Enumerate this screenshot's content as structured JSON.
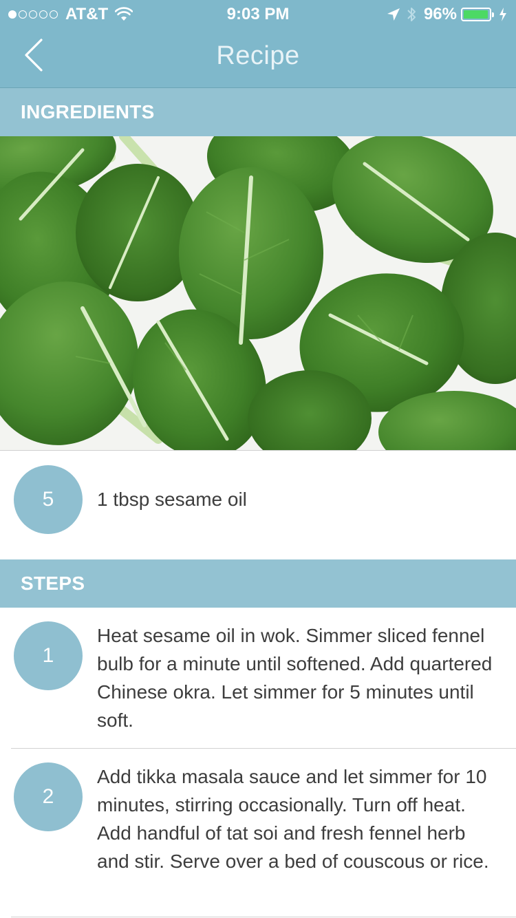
{
  "status_bar": {
    "signal_dots_filled": 1,
    "signal_dots_total": 5,
    "carrier": "AT&T",
    "time": "9:03 PM",
    "battery_percent_text": "96%",
    "battery_level": 0.96,
    "colors": {
      "bar": "#7fb8cb",
      "battery_fill": "#4cd964"
    }
  },
  "nav": {
    "title": "Recipe",
    "back_icon": "chevron-left-icon"
  },
  "ingredients": {
    "header": "INGREDIENTS",
    "items": [
      {
        "badge": "5",
        "text": "1 tbsp sesame oil"
      }
    ]
  },
  "steps": {
    "header": "STEPS",
    "items": [
      {
        "badge": "1",
        "text": "Heat sesame oil in wok. Simmer sliced fennel bulb for a minute until softened. Add quartered Chinese okra. Let simmer for 5 minutes until soft."
      },
      {
        "badge": "2",
        "text": "Add tikka masala sauce and let simmer for 10 minutes, stirring occasionally. Turn off heat. Add handful of tat soi and fresh fennel herb and stir. Serve over a bed of couscous or rice."
      }
    ]
  },
  "theme": {
    "header_bg": "#93c2d2",
    "badge_bg": "#8fbfd0",
    "text_color": "#3d3d3d"
  }
}
